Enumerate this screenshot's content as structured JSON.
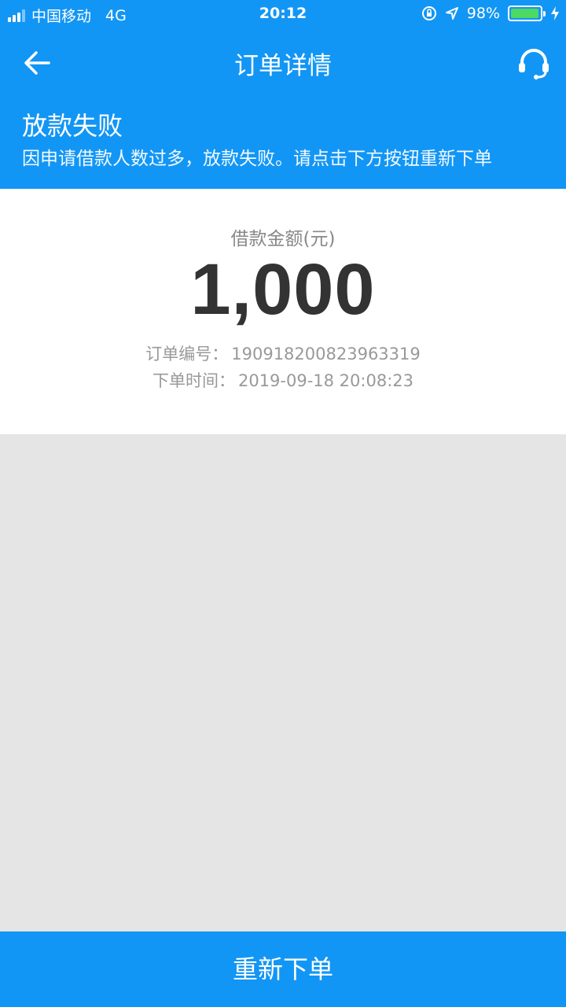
{
  "status_bar": {
    "carrier": "中国移动",
    "network": "4G",
    "time": "20:12",
    "battery": "98%",
    "battery_level": 0.98
  },
  "navbar": {
    "title": "订单详情",
    "back_icon": "arrow-left-icon",
    "service_icon": "headset-icon"
  },
  "banner": {
    "title": "放款失败",
    "message": "因申请借款人数过多，放款失败。请点击下方按钮重新下单"
  },
  "loan": {
    "amount_label": "借款金额(元)",
    "amount": "1,000",
    "order_no_label": "订单编号：",
    "order_no": "190918200823963319",
    "order_time_label": "下单时间：",
    "order_time": "2019-09-18 20:08:23"
  },
  "actions": {
    "reorder_label": "重新下单"
  },
  "colors": {
    "primary": "#1296f5",
    "background": "#e5e5e5"
  }
}
